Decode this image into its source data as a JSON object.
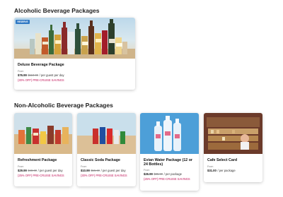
{
  "sections": {
    "alcoholic_title": "Alcoholic Beverage Packages",
    "non_alcoholic_title": "Non-Alcoholic Beverage Packages"
  },
  "alcoholic_packages": [
    {
      "badge": "RESERVE",
      "name": "Deluxe Beverage Package",
      "from": "From",
      "price": "$76.99",
      "original_price": "$110.00",
      "per": "/ per guest per day",
      "savings": "(30% OFF) PRE-CRUISE SAVINGS"
    }
  ],
  "non_alcoholic_packages": [
    {
      "name": "Refreshment Package",
      "from": "From",
      "price": "$29.99",
      "original_price": "$40.00",
      "per": "/ per guest per day",
      "savings": "(25% OFF) PRE-CRUISE SAVINGS"
    },
    {
      "name": "Classic Soda Package",
      "from": "From",
      "price": "$10.99",
      "original_price": "$15.69",
      "per": "/ per guest per day",
      "savings": "(30% OFF) PRE-CRUISE SAVINGS"
    },
    {
      "name": "Evian Water Package (12 or 24 Bottles)",
      "from": "From",
      "price": "$26.99",
      "original_price": "$35.99",
      "per": "/ per package",
      "savings": "(25% OFF) PRE-CRUISE SAVINGS"
    },
    {
      "name": "Cafe Select Card",
      "from": "From",
      "price": "$31.00",
      "original_price": "",
      "per": "/ per package",
      "savings": ""
    }
  ],
  "colors": {
    "savings": "#c2185b",
    "badge": "#2f78c4"
  }
}
